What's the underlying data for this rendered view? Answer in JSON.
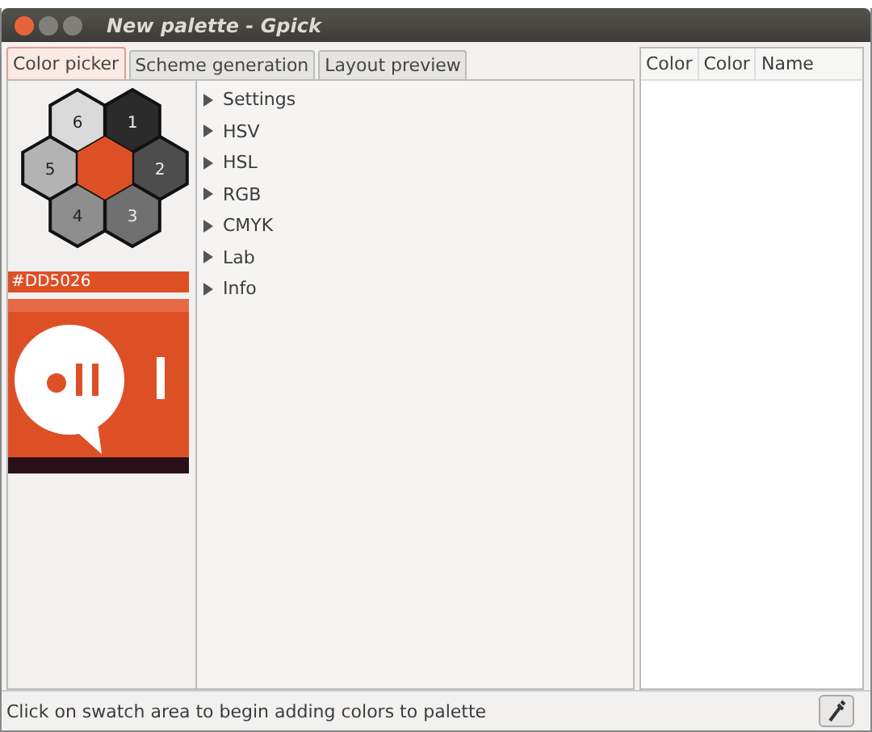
{
  "window": {
    "title": "New palette - Gpick"
  },
  "tabs": [
    {
      "label": "Color picker",
      "selected": true
    },
    {
      "label": "Scheme generation",
      "selected": false
    },
    {
      "label": "Layout preview",
      "selected": false
    }
  ],
  "swatches": [
    {
      "label": "1",
      "color": "#2b2b2b"
    },
    {
      "label": "2",
      "color": "#4d4d4d"
    },
    {
      "label": "3",
      "color": "#707070"
    },
    {
      "label": "4",
      "color": "#8e8e8e"
    },
    {
      "label": "5",
      "color": "#b3b3b3"
    },
    {
      "label": "6",
      "color": "#dadada"
    }
  ],
  "current_color": {
    "value": "#DD5026",
    "color": "#dd5026"
  },
  "sections": [
    {
      "label": "Settings",
      "expanded": false
    },
    {
      "label": "HSV",
      "expanded": false
    },
    {
      "label": "HSL",
      "expanded": false
    },
    {
      "label": "RGB",
      "expanded": false
    },
    {
      "label": "CMYK",
      "expanded": false
    },
    {
      "label": "Lab",
      "expanded": false
    },
    {
      "label": "Info",
      "expanded": false
    }
  ],
  "palette": {
    "columns": [
      "Color",
      "Color",
      "Name"
    ]
  },
  "status_bar": {
    "text": "Click on swatch area to begin adding colors to palette"
  }
}
